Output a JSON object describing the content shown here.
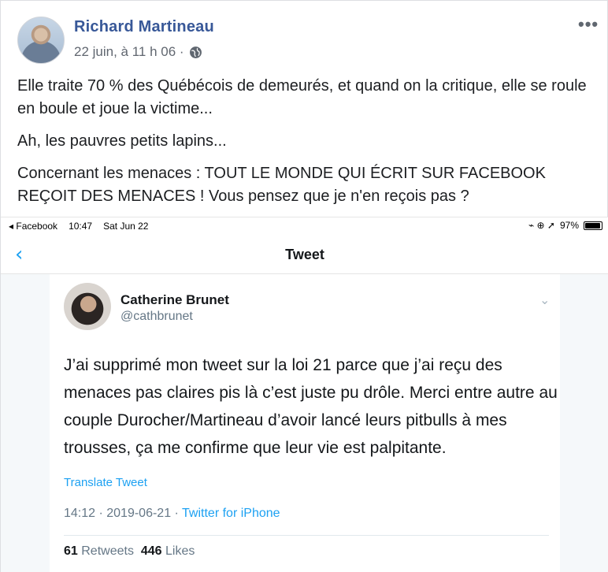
{
  "post": {
    "author": "Richard Martineau",
    "timestamp": "22 juin, à 11 h 06 ·",
    "paragraphs": [
      "Elle traite 70 % des Québécois de demeurés, et quand on la critique, elle se roule en boule et joue la victime...",
      "Ah, les pauvres petits lapins...",
      "Concernant les menaces : TOUT LE MONDE QUI ÉCRIT SUR FACEBOOK REÇOIT DES MENACES ! Vous pensez que je n'en reçois pas ?"
    ],
    "more_label": "•••"
  },
  "screenshot": {
    "status": {
      "app": "◂ Facebook",
      "time": "10:47",
      "date": "Sat Jun 22",
      "indicators": "⌁ ⊕ ➚",
      "battery": "97%"
    },
    "nav": {
      "back_label": "‹",
      "title": "Tweet"
    },
    "tweet": {
      "name": "Catherine Brunet",
      "handle": "@cathbrunet",
      "body": "J’ai supprimé mon tweet sur la loi 21 parce que j’ai reçu des menaces pas claires pis là c’est juste pu drôle. Merci entre autre au couple Durocher/Martineau d’avoir lancé leurs pitbulls à mes trousses, ça me confirme que leur vie est palpitante.",
      "translate": "Translate Tweet",
      "time_date": "14:12 · 2019-06-21 · ",
      "source": "Twitter for iPhone",
      "retweets_count": "61",
      "retweets_label": "Retweets",
      "likes_count": "446",
      "likes_label": "Likes"
    }
  },
  "colors": {
    "fb_blue": "#385898",
    "twitter_blue": "#1da1f2"
  },
  "icons": [
    "globe-icon",
    "more-icon",
    "back-icon",
    "chevron-down-icon",
    "wifi-icon",
    "battery-icon"
  ]
}
